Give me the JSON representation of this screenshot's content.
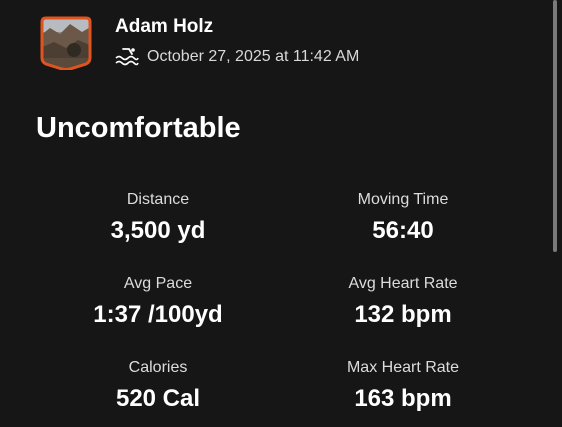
{
  "athlete": {
    "name": "Adam Holz",
    "activity_type_icon": "swim-icon",
    "timestamp": "October 27, 2025 at 11:42 AM"
  },
  "activity": {
    "title": "Uncomfortable"
  },
  "stats": [
    {
      "label": "Distance",
      "value": "3,500 yd"
    },
    {
      "label": "Moving Time",
      "value": "56:40"
    },
    {
      "label": "Avg Pace",
      "value": "1:37 /100yd"
    },
    {
      "label": "Avg Heart Rate",
      "value": "132 bpm"
    },
    {
      "label": "Calories",
      "value": "520 Cal"
    },
    {
      "label": "Max Heart Rate",
      "value": "163 bpm"
    }
  ],
  "colors": {
    "background": "#161616",
    "avatar_border": "#e0541f"
  }
}
